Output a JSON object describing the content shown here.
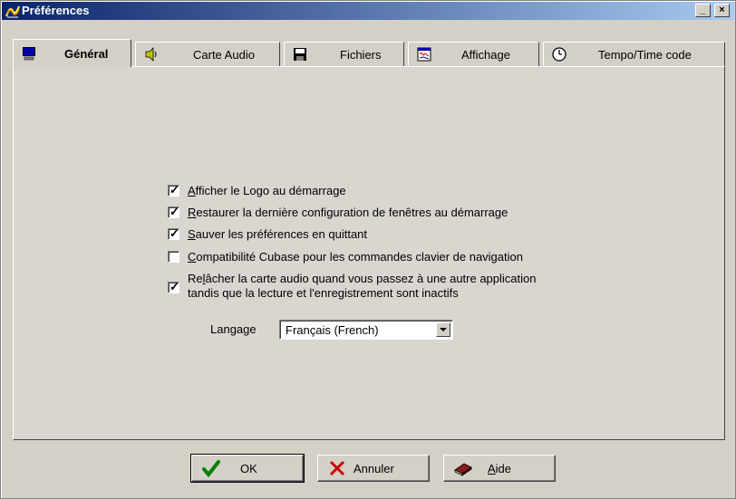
{
  "window": {
    "title": "Préférences"
  },
  "tabs": [
    {
      "label": "Général",
      "icon": "monitor-icon",
      "active": true
    },
    {
      "label": "Carte Audio",
      "icon": "speaker-icon"
    },
    {
      "label": "Fichiers",
      "icon": "floppy-disk-icon"
    },
    {
      "label": "Affichage",
      "icon": "display-window-icon"
    },
    {
      "label": "Tempo/Time code",
      "icon": "clock-icon"
    }
  ],
  "options": [
    {
      "accel": "A",
      "rest": "fficher le Logo au démarrage",
      "checked": true
    },
    {
      "accel": "R",
      "rest": "estaurer la dernière configuration de fenêtres au démarrage",
      "checked": true
    },
    {
      "accel": "S",
      "rest": "auver les préférences en quittant",
      "checked": true
    },
    {
      "accel": "C",
      "rest": "ompatibilité Cubase pour les commandes clavier de navigation",
      "checked": false
    },
    {
      "pre": "Re",
      "accel": "l",
      "rest": "âcher la carte audio quand vous passez à une autre application",
      "line2": "tandis que la lecture et l'enregistrement sont inactifs",
      "checked": true
    }
  ],
  "language": {
    "label": "Langage",
    "value": "Français (French)"
  },
  "buttons": {
    "ok": "OK",
    "cancel": "Annuler",
    "help_accel": "A",
    "help_rest": "ide"
  },
  "colors": {
    "titlebar_start": "#0a246a",
    "titlebar_end": "#a6caf0",
    "face": "#d4d0c8"
  }
}
